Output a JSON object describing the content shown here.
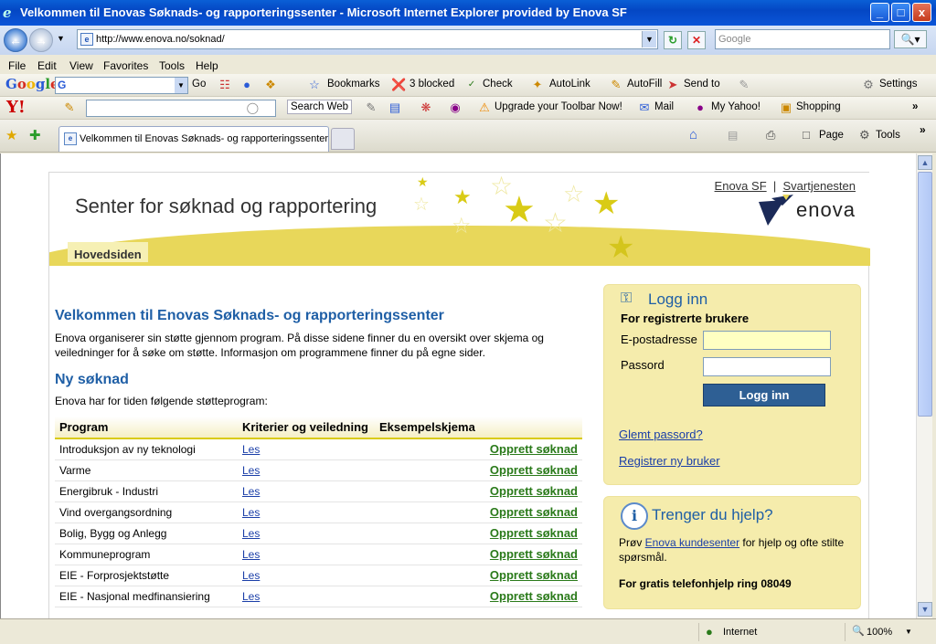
{
  "window": {
    "title": "Velkommen til Enovas Søknads- og rapporteringssenter - Microsoft Internet Explorer provided by Enova SF",
    "min_label": "_",
    "max_label": "□",
    "close_label": "x"
  },
  "address": {
    "url": "http://www.enova.no/soknad/",
    "search_placeholder": "Google"
  },
  "menu": [
    "File",
    "Edit",
    "View",
    "Favorites",
    "Tools",
    "Help"
  ],
  "google_toolbar": {
    "logo": "Google",
    "go": "Go",
    "bookmarks": "Bookmarks",
    "blocked": "3 blocked",
    "check": "Check",
    "autolink": "AutoLink",
    "autofill": "AutoFill",
    "sendto": "Send to",
    "settings": "Settings"
  },
  "yahoo_toolbar": {
    "logo": "Y!",
    "search_web": "Search Web",
    "upgrade": "Upgrade your Toolbar Now!",
    "mail": "Mail",
    "my_yahoo": "My Yahoo!",
    "shopping": "Shopping"
  },
  "tabs": {
    "active_label": "Velkommen til Enovas Søknads- og rapporteringssenter",
    "page_label": "Page",
    "tools_label": "Tools"
  },
  "site": {
    "title": "Senter for søknad og rapportering",
    "top_link_1": "Enova SF",
    "top_sep": "|",
    "top_link_2": "Svartjenesten",
    "logo": "enova",
    "nav_tab": "Hovedsiden"
  },
  "main": {
    "heading": "Velkommen til Enovas Søknads- og rapporteringssenter",
    "intro": "Enova organiserer sin støtte gjennom program. På disse sidene finner du en oversikt over skjema og veiledninger for å søke om støtte. Informasjon om programmene finner du på egne sider.",
    "new_heading": "Ny søknad",
    "new_sub": "Enova har for tiden følgende støtteprogram:",
    "columns": [
      "Program",
      "Kriterier og veiledning",
      "Eksempelskjema",
      ""
    ],
    "rows": [
      {
        "program": "Introduksjon av ny teknologi",
        "link": "Les",
        "action": "Opprett søknad"
      },
      {
        "program": "Varme",
        "link": "Les",
        "action": "Opprett søknad"
      },
      {
        "program": "Energibruk - Industri",
        "link": "Les",
        "action": "Opprett søknad"
      },
      {
        "program": "Vind overgangsordning",
        "link": "Les",
        "action": "Opprett søknad"
      },
      {
        "program": "Bolig, Bygg og Anlegg",
        "link": "Les",
        "action": "Opprett søknad"
      },
      {
        "program": "Kommuneprogram",
        "link": "Les",
        "action": "Opprett søknad"
      },
      {
        "program": "EIE - Forprosjektstøtte",
        "link": "Les",
        "action": "Opprett søknad"
      },
      {
        "program": "EIE - Nasjonal medfinansiering",
        "link": "Les",
        "action": "Opprett søknad"
      }
    ]
  },
  "login": {
    "heading": "Logg inn",
    "sub": "For registrerte brukere",
    "email_label": "E-postadresse",
    "password_label": "Passord",
    "button": "Logg inn",
    "forgot": "Glemt passord?",
    "register": "Registrer ny bruker"
  },
  "help": {
    "heading": "Trenger du hjelp?",
    "text_before": "Prøv ",
    "link": "Enova kundesenter",
    "text_after": " for hjelp og ofte stilte spørsmål.",
    "phone": "For gratis telefonhjelp ring 08049"
  },
  "status": {
    "zone": "Internet",
    "zoom": "100%"
  },
  "colors": {
    "heading_blue": "#1f5fa6",
    "enova_yellow": "#e8d75a",
    "link_green": "#2a7a1a",
    "button_blue": "#2e5f94"
  }
}
